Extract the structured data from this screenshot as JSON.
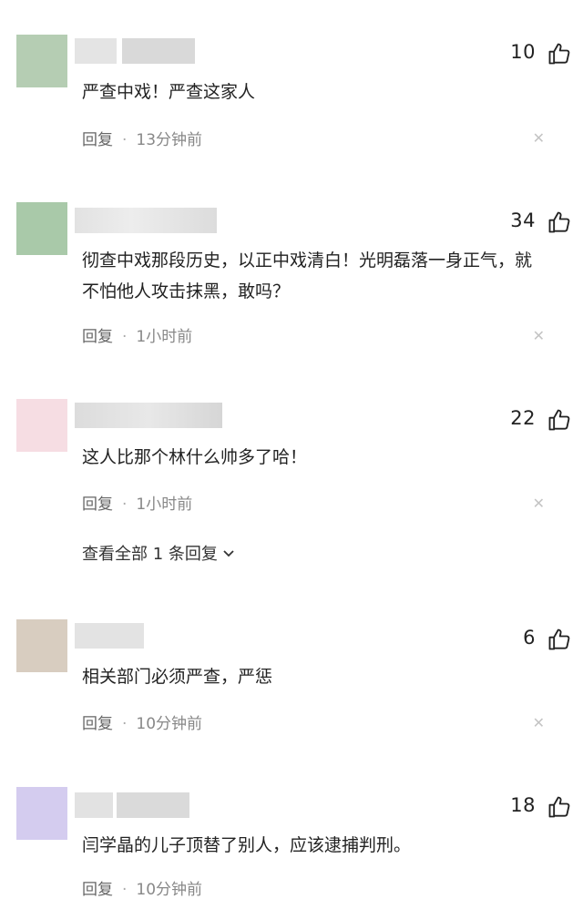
{
  "comments": [
    {
      "avatar_color": "#b5cdb3",
      "likes": "10",
      "text": "严查中戏！严查这家人",
      "reply_label": "回复",
      "time": "13分钟前"
    },
    {
      "avatar_color": "#a9c9a9",
      "likes": "34",
      "text": "彻查中戏那段历史，以正中戏清白！光明磊落一身正气，就不怕他人攻击抹黑，敢吗？",
      "reply_label": "回复",
      "time": "1小时前"
    },
    {
      "avatar_color": "#f6dde3",
      "likes": "22",
      "text": "这人比那个林什么帅多了哈！",
      "reply_label": "回复",
      "time": "1小时前",
      "more_replies": "查看全部 1 条回复"
    },
    {
      "avatar_color": "#d8cdc0",
      "likes": "6",
      "text": "相关部门必须严查，严惩",
      "reply_label": "回复",
      "time": "10分钟前"
    },
    {
      "avatar_color": "#d4ccef",
      "likes": "18",
      "text": "闫学晶的儿子顶替了别人，应该逮捕判刑。",
      "reply_label": "回复",
      "time": "10分钟前"
    }
  ],
  "icons": {
    "like": "thumbs-up-icon",
    "close": "close-icon",
    "expand": "chevron-down-icon"
  }
}
